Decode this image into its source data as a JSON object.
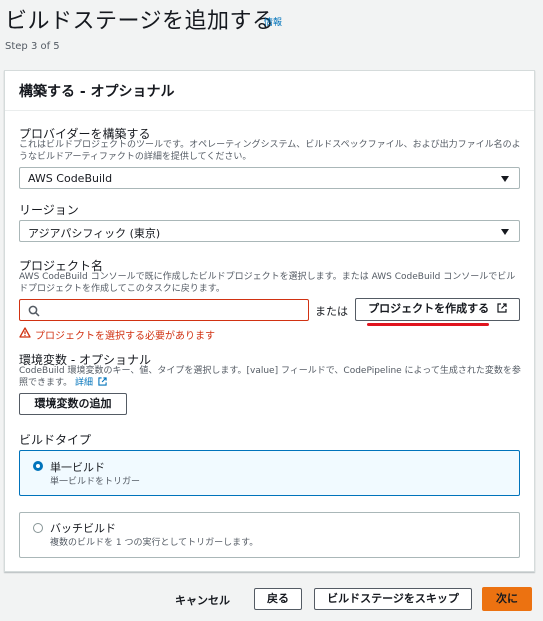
{
  "header": {
    "title": "ビルドステージを追加する",
    "info_link": "情報",
    "step": "Step 3 of 5"
  },
  "card": {
    "title": "構築する - オプショナル",
    "provider": {
      "label": "プロバイダーを構築する",
      "description": "これはビルドプロジェクトのツールです。オペレーティングシステム、ビルドスペックファイル、および出力ファイル名のようなビルドアーティファクトの詳細を提供してください。",
      "value": "AWS CodeBuild"
    },
    "region": {
      "label": "リージョン",
      "value": "アジアパシフィック (東京)"
    },
    "project": {
      "label": "プロジェクト名",
      "description": "AWS CodeBuild コンソールで既に作成したビルドプロジェクトを選択します。または AWS CodeBuild コンソールでビルドプロジェクトを作成してこのタスクに戻ります。",
      "search_value": "",
      "or_text": "または",
      "create_button": "プロジェクトを作成する",
      "error": "プロジェクトを選択する必要があります"
    },
    "env": {
      "label": "環境変数 - オプショナル",
      "description": "CodeBuild 環境変数のキー、値、タイプを選択します。[value] フィールドで、CodePipeline によって生成された変数を参照できます。",
      "detail_link": "詳細",
      "add_button": "環境変数の追加"
    },
    "build_type": {
      "label": "ビルドタイプ",
      "options": [
        {
          "title": "単一ビルド",
          "description": "単一ビルドをトリガー",
          "selected": true
        },
        {
          "title": "バッチビルド",
          "description": "複数のビルドを 1 つの実行としてトリガーします。",
          "selected": false
        }
      ]
    }
  },
  "footer": {
    "cancel": "キャンセル",
    "back": "戻る",
    "skip": "ビルドステージをスキップ",
    "next": "次に"
  },
  "colors": {
    "accent": "#0073bb",
    "error": "#d13212",
    "primary": "#ec7211",
    "annotation": "#e0141e"
  }
}
